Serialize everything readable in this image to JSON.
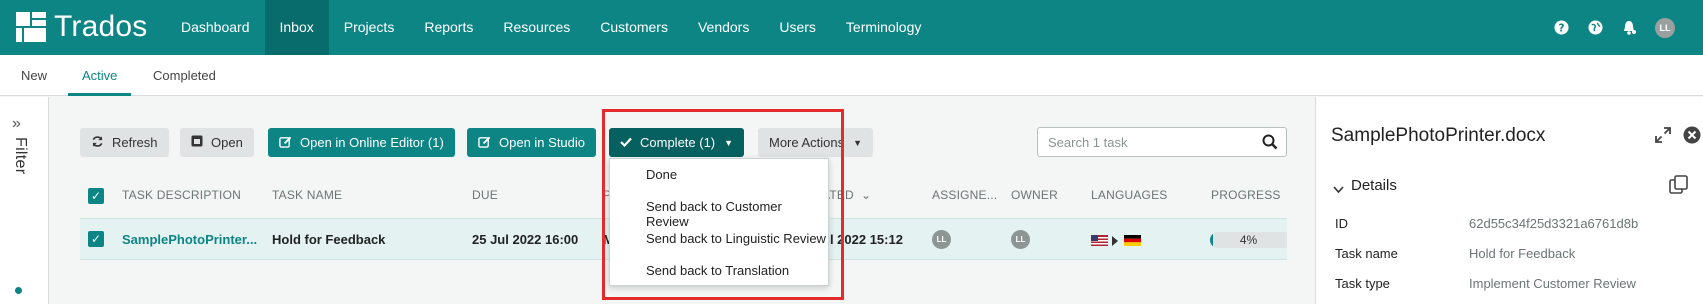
{
  "app": {
    "name": "Trados"
  },
  "nav": [
    "Dashboard",
    "Inbox",
    "Projects",
    "Reports",
    "Resources",
    "Customers",
    "Vendors",
    "Users",
    "Terminology"
  ],
  "nav_active": "Inbox",
  "user": {
    "initials": "LL"
  },
  "subtabs": [
    "New",
    "Active",
    "Completed"
  ],
  "subtab_active": "Active",
  "filter": {
    "label": "Filter"
  },
  "toolbar": {
    "refresh": "Refresh",
    "open": "Open",
    "online_editor": "Open in Online Editor (1)",
    "studio": "Open in Studio",
    "complete": "Complete (1)",
    "more": "More Actions"
  },
  "search": {
    "placeholder": "Search 1 task"
  },
  "table": {
    "columns": [
      "TASK DESCRIPTION",
      "TASK NAME",
      "DUE",
      "P",
      "ATED",
      "ASSIGNE...",
      "OWNER",
      "LANGUAGES",
      "PROGRESS"
    ],
    "rows": [
      {
        "description": "SamplePhotoPrinter...",
        "task_name": "Hold for Feedback",
        "due": "25 Jul 2022 16:00",
        "partial": "M",
        "created": "ul 2022 15:12",
        "assignee": "LL",
        "owner": "LL",
        "progress_text": "4%",
        "progress_value": 0.04
      }
    ]
  },
  "complete_menu": [
    "Done",
    "Send back to Customer Review",
    "Send back to Linguistic Review",
    "Send back to Translation"
  ],
  "details": {
    "title": "SamplePhotoPrinter.docx",
    "section": "Details",
    "fields": [
      {
        "label": "ID",
        "value": "62d55c34f25d3321a6761d8b"
      },
      {
        "label": "Task name",
        "value": "Hold for Feedback"
      },
      {
        "label": "Task type",
        "value": "Implement Customer Review"
      }
    ]
  },
  "colors": {
    "brand": "#0d8585",
    "highlight": "#e32b2b"
  }
}
